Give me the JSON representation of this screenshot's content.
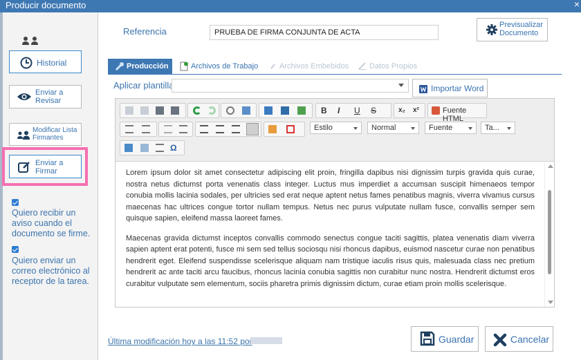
{
  "window": {
    "title": "Producir documento",
    "close_glyph": "×"
  },
  "sidebar": {
    "history_label": "Historial",
    "review_label": "Enviar a Revisar",
    "modify_signers_label": "Modificar Lista Firmantes",
    "send_sign_label": "Enviar a Firmar",
    "checkbox1_text": "Quiero recibir un aviso cuando el documento se firme.",
    "checkbox2_text": "Quiero enviar un correo electrónico al receptor de la tarea."
  },
  "header": {
    "reference_label": "Referencia",
    "reference_value": "PRUEBA DE FIRMA CONJUNTA DE ACTA",
    "preview_label": "Previsualizar Documento"
  },
  "tabs": [
    {
      "label": "Producción"
    },
    {
      "label": "Archivos de Trabajo"
    },
    {
      "label": "Archivos Embebidos"
    },
    {
      "label": "Datos Propios"
    }
  ],
  "template": {
    "label": "Aplicar plantilla",
    "value": "",
    "import_word_label": "Importar Word"
  },
  "toolbar": {
    "source_html_label": "Fuente HTML",
    "style_label": "Estilo",
    "format_label": "Normal",
    "font_label": "Fuente",
    "size_label": "Ta..."
  },
  "editor": {
    "paragraphs": [
      "Lorem ipsum dolor sit amet consectetur adipiscing elit proin, fringilla dapibus nisi dignissim turpis gravida quis curae, nostra netus dictumst porta venenatis class integer. Luctus mus imperdiet a accumsan suscipit himenaeos tempor conubia mollis lacinia sodales, per ultricies sed erat neque aptent netus fames penatibus magnis, viverra vivamus cursus maecenas hac ultrices congue tortor nullam tempus. Netus nec purus vulputate nullam fusce, convallis semper sem quisque sapien, eleifend massa laoreet fames.",
      "Maecenas gravida dictumst inceptos convallis commodo senectus congue taciti sagittis, platea venenatis diam viverra sapien aptent erat potenti, fusce mi sem sed tellus sociosqu nisi rhoncus dapibus, euismod nascetur curae non penatibus hendrerit eget. Eleifend suspendisse scelerisque aliquam nam tristique iaculis risus quis, malesuada class nec pretium hendrerit ac ante taciti arcu faucibus, rhoncus lacinia conubia sagittis non curabitur nunc nostra. Hendrerit dictumst eros curabitur vulputate sem elementum, sociis pharetra primis dignissim dictum, curae etiam proin mollis scelerisque."
    ]
  },
  "footer": {
    "last_modified": "Última modificación hoy a las 11:52 por",
    "save_label": "Guardar",
    "cancel_label": "Cancelar"
  },
  "colors": {
    "accent": "#3e78b3",
    "highlight": "#f56fb1",
    "link": "#3c74ad"
  }
}
